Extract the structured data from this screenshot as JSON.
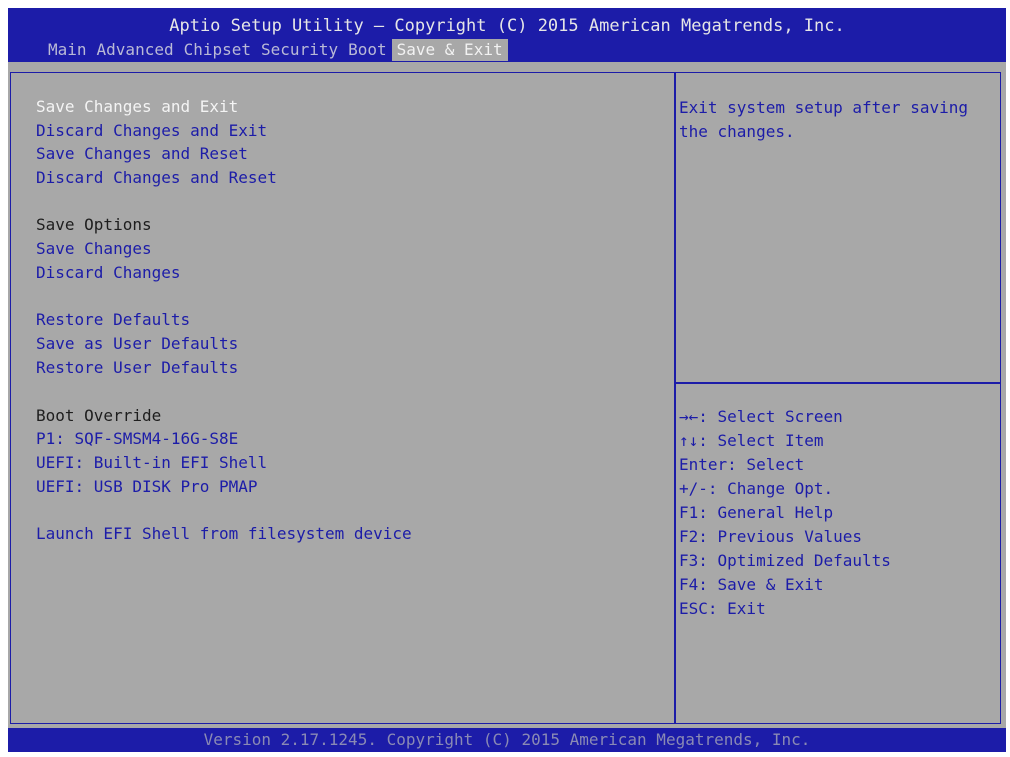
{
  "header": {
    "title": "Aptio Setup Utility – Copyright (C) 2015 American Megatrends, Inc.",
    "tabs": [
      "Main",
      "Advanced",
      "Chipset",
      "Security",
      "Boot",
      "Save & Exit"
    ],
    "active_tab": "Save & Exit"
  },
  "menu": {
    "save_changes_and_exit": "Save Changes and Exit",
    "discard_changes_and_exit": "Discard Changes and Exit",
    "save_changes_and_reset": "Save Changes and Reset",
    "discard_changes_and_reset": "Discard Changes and Reset",
    "save_options_heading": "Save Options",
    "save_changes": "Save Changes",
    "discard_changes": "Discard Changes",
    "restore_defaults": "Restore Defaults",
    "save_as_user_defaults": "Save as User Defaults",
    "restore_user_defaults": "Restore User Defaults",
    "boot_override_heading": "Boot Override",
    "boot_p1": "P1: SQF-SMSM4-16G-S8E",
    "boot_uefi_shell": "UEFI: Built-in EFI Shell",
    "boot_uefi_usb": "UEFI:  USB DISK Pro PMAP",
    "launch_efi_shell": "Launch EFI Shell from filesystem device"
  },
  "help": {
    "text": "Exit system setup after saving the changes."
  },
  "keys": [
    "→←: Select Screen",
    "↑↓: Select Item",
    "Enter: Select",
    "+/-: Change Opt.",
    "F1: General Help",
    "F2: Previous Values",
    "F3: Optimized Defaults",
    "F4: Save & Exit",
    "ESC: Exit"
  ],
  "footer": {
    "text": "Version 2.17.1245. Copyright (C) 2015 American Megatrends, Inc."
  },
  "colors": {
    "blue": "#1c1ca8",
    "panel_gray": "#a8a8a8",
    "selected_text": "#f4f4f4"
  }
}
